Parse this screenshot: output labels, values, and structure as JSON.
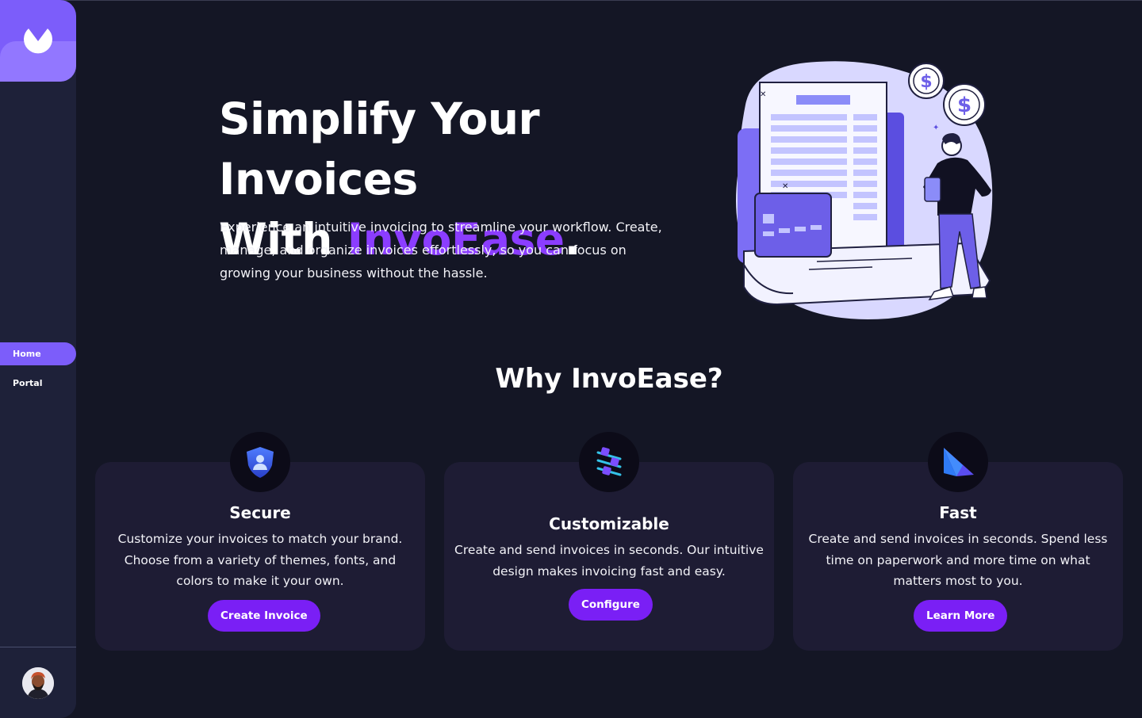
{
  "nav": {
    "items": [
      {
        "label": "Home",
        "active": true
      },
      {
        "label": "Portal",
        "active": false
      }
    ]
  },
  "hero": {
    "title_line1": "Simplify Your Invoices",
    "title_prefix": "With ",
    "title_brand": "InvoEase",
    "title_suffix": ".",
    "description": "Experience an intuitive invoicing to streamline your workflow. Create, manage, and organize invoices effortlessly, so you can focus on growing your business without the hassle."
  },
  "section": {
    "title": "Why InvoEase?"
  },
  "features": [
    {
      "icon": "shield-user-icon",
      "title": "Secure",
      "text": "Customize your invoices to match your brand. Choose from a variety of themes, fonts, and colors to make it your own.",
      "button": "Create Invoice"
    },
    {
      "icon": "sliders-icon",
      "title": "Customizable",
      "text": "Create and send invoices in seconds. Our intuitive design makes invoicing fast and easy.",
      "button": "Configure"
    },
    {
      "icon": "prism-icon",
      "title": "Fast",
      "text": "Create and send invoices in seconds. Spend less time on paperwork and more time on what matters most to you.",
      "button": "Learn More"
    }
  ],
  "colors": {
    "background": "#141625",
    "sidebar": "#1e2139",
    "accent": "#7c5dfa",
    "brand_text": "#8b3dff",
    "button": "#7a1ff5",
    "card": "#1e1c34"
  }
}
